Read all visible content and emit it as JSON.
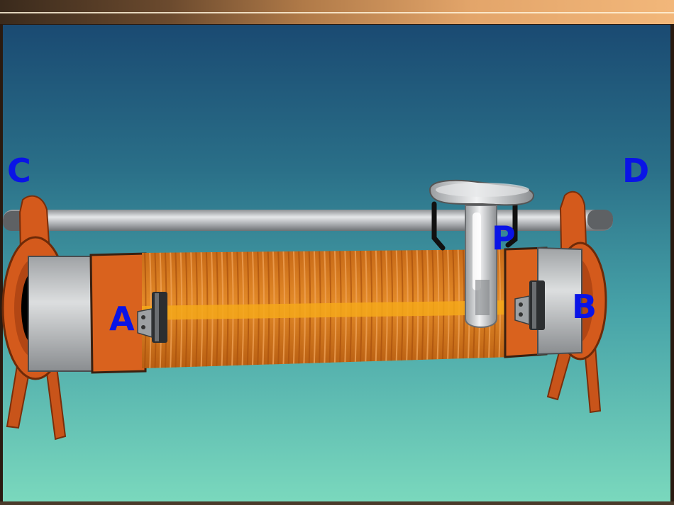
{
  "labels": {
    "a": "A",
    "b": "B",
    "c": "C",
    "d": "D",
    "p": "P"
  },
  "colors": {
    "label": "#0a14e6",
    "stand": "#d45a1c",
    "coil": "#d9781f",
    "coil_highlight": "#f4a81a",
    "rod": "#b9bcbf",
    "band": "#c7c9cb"
  },
  "coil": {
    "turn_count": 72
  }
}
